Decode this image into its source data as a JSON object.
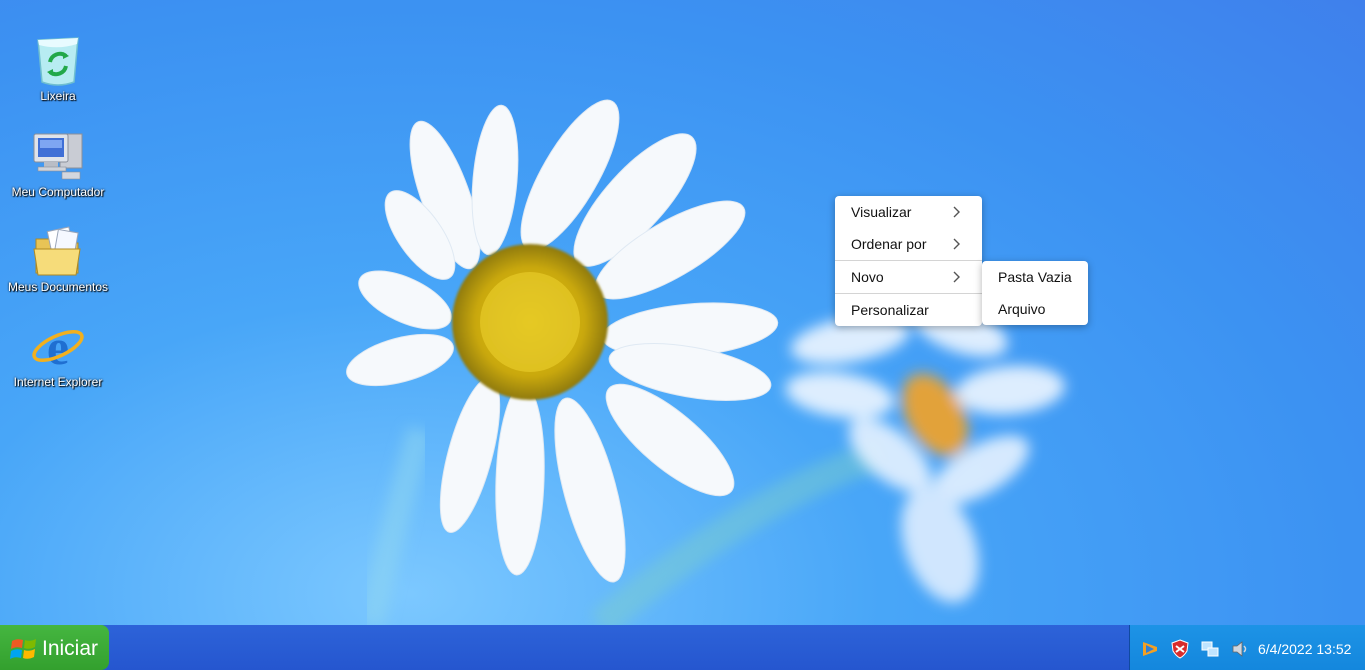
{
  "desktop": {
    "icons": [
      {
        "label": "Lixeira",
        "icon": "recycle-bin-icon"
      },
      {
        "label": "Meu Computador",
        "icon": "my-computer-icon"
      },
      {
        "label": "Meus Documentos",
        "icon": "my-documents-icon"
      },
      {
        "label": "Internet Explorer",
        "icon": "internet-explorer-icon"
      }
    ]
  },
  "context_menu": {
    "items": [
      {
        "label": "Visualizar",
        "has_submenu": true
      },
      {
        "label": "Ordenar por",
        "has_submenu": true
      },
      {
        "label": "Novo",
        "has_submenu": true
      },
      {
        "label": "Personalizar",
        "has_submenu": false
      }
    ],
    "submenu_novo": {
      "items": [
        {
          "label": "Pasta Vazia"
        },
        {
          "label": "Arquivo"
        }
      ]
    }
  },
  "taskbar": {
    "start_label": "Iniciar",
    "tray_icons": [
      "media-player-icon",
      "security-shield-icon",
      "network-icon",
      "volume-icon"
    ],
    "clock": "6/4/2022 13:52",
    "colors": {
      "taskbar": "#2556cf",
      "start": "#3aa634",
      "tray": "#1a8fe3"
    }
  }
}
